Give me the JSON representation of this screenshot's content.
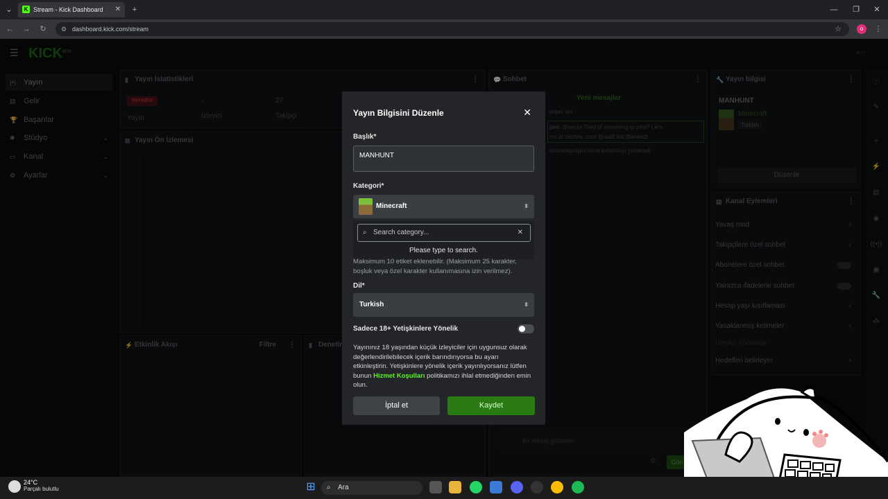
{
  "browser": {
    "tab_title": "Stream - Kick Dashboard",
    "url": "dashboard.kick.com/stream",
    "profile_initial": "o"
  },
  "kick": {
    "logo": "KICK",
    "beta": "BETA",
    "nav": [
      {
        "label": "Yayın",
        "icon": "broadcast-icon"
      },
      {
        "label": "Gelir",
        "icon": "revenue-icon"
      },
      {
        "label": "Başarılar",
        "icon": "trophy-icon"
      },
      {
        "label": "Stüdyo",
        "icon": "studio-icon"
      },
      {
        "label": "Kanal",
        "icon": "channel-icon"
      },
      {
        "label": "Ayarlar",
        "icon": "gear-icon"
      }
    ],
    "stats_panel": {
      "title": "Yayın İstatistikleri",
      "live_badge": "YAYINDA",
      "stream_label": "Yayın",
      "viewers_value": "-",
      "viewers_label": "İzleyici",
      "followers_value": "27",
      "followers_label": "Takipçi"
    },
    "preview_panel": {
      "title": "Yayın Ön İzlemesi"
    },
    "activity_panel": {
      "title": "Etkinlik Akışı",
      "filter": "Filtre"
    },
    "moderation_panel": {
      "title": "Denetim"
    },
    "chat_panel": {
      "title": "Sohbet",
      "new_messages": "Yeni mesajlar",
      "message1": "selam abi",
      "message2_user": "jani:",
      "message2": "@sevze Tired of streaming to zero? Let's",
      "message2b": "my at nezhna .com @aatlli kid (Banned)",
      "message3": "nestrackpotjani isimli kullanıcıyı yasakladı",
      "input_placeholder": "Bir mesaj gönderin",
      "send_label": "Gön"
    },
    "info_panel": {
      "title": "Yayın bilgisi",
      "stream_title": "MANHUNT",
      "category": "Minecraft",
      "language": "Turkish",
      "edit_button": "Düzenle"
    },
    "channel_actions": {
      "title": "Kanal Eylemleri",
      "items": [
        "Yavaş mod",
        "Takipçilere özel sohbet",
        "Abonelere özel sohbet",
        "Yalnızca ifadelerle sohbet",
        "Hesap yaşı kısıtlaması",
        "Yasaklanmış kelimeler",
        "İzleyici Yönlendir",
        "Hedefleri belirleyin"
      ]
    }
  },
  "modal": {
    "title": "Yayın Bilgisini Düzenle",
    "title_label": "Başlık*",
    "title_value": "MANHUNT",
    "category_label": "Kategori*",
    "category_value": "Minecraft",
    "search_placeholder": "Search category...",
    "search_hint": "Please type to search.",
    "tags_note": "Maksimum 10 etiket eklenebilir. (Maksimum 25 karakter, boşluk veya özel karakter kullanımasına izin verilmez).",
    "language_label": "Dil*",
    "language_value": "Turkish",
    "adult_label": "Sadece 18+ Yetişkinlere Yönelik",
    "adult_desc_1": "Yayınınız 18 yaşından küçük izleyiciler için uygunsuz olarak değerlendirilebilecek içerik barındırıyorsa bu ayarı etkinleştirin. Yetişkinlere yönelik içerik yayınlıyorsanız lütfen bunun",
    "adult_desc_link": "Hizmet Koşulları",
    "adult_desc_2": "politikamızı ihlal etmediğinden emin olun.",
    "cancel": "İptal et",
    "save": "Kaydet"
  },
  "taskbar": {
    "temperature": "24°C",
    "weather": "Parçalı bulutlu",
    "search": "Ara"
  }
}
